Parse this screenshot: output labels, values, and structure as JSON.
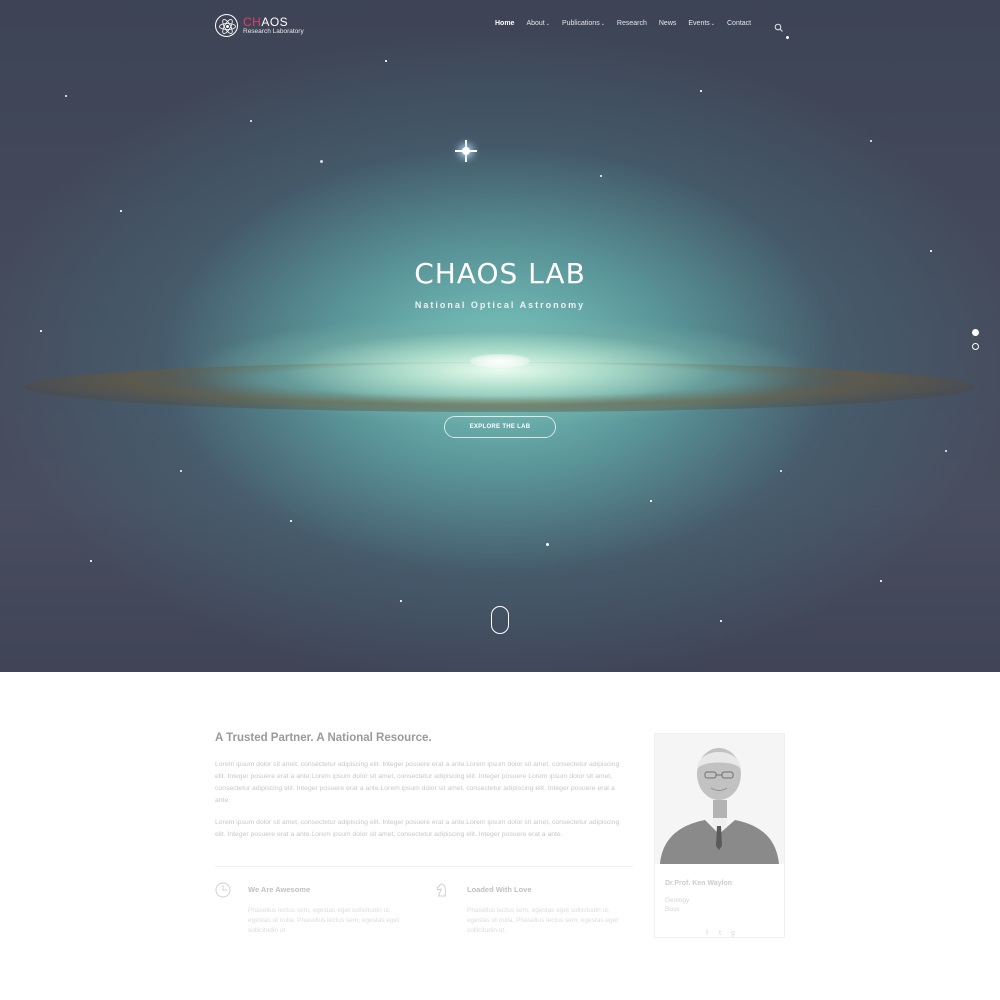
{
  "brand": {
    "name_accent": "CH",
    "name_rest": "AOS",
    "subtitle": "Research Laboratory",
    "accent_color": "#e0406a"
  },
  "nav": {
    "items": [
      {
        "label": "Home",
        "active": true,
        "dropdown": false
      },
      {
        "label": "About",
        "active": false,
        "dropdown": true
      },
      {
        "label": "Publications",
        "active": false,
        "dropdown": true
      },
      {
        "label": "Research",
        "active": false,
        "dropdown": false
      },
      {
        "label": "News",
        "active": false,
        "dropdown": false
      },
      {
        "label": "Events",
        "active": false,
        "dropdown": true
      },
      {
        "label": "Contact",
        "active": false,
        "dropdown": false
      }
    ],
    "search_icon": "search-icon"
  },
  "hero": {
    "title": "CHAOS LAB",
    "subtitle": "National Optical Astronomy",
    "button_label": "EXPLORE THE LAB",
    "slides": {
      "count": 2,
      "active_index": 0
    }
  },
  "about": {
    "title": "A Trusted Partner. A National Resource.",
    "paragraphs": [
      "Lorem ipsum dolor sit amet, consectetur adipiscing elit. Integer posuere erat a ante.Lorem ipsum dolor sit amet, consectetur adipiscing elit. Integer posuere erat a ante.Lorem ipsum dolor sit amet, consectetur adipiscing elit. Integer posuere Lorem ipsum dolor sit amet, consectetur adipiscing elit. Integer posuere erat a ante.Lorem ipsum dolor sit amet, consectetur adipiscing elit. Integer posuere erat a ante.",
      "Lorem ipsum dolor sit amet, consectetur adipiscing elit. Integer posuere erat a ante.Lorem ipsum dolor sit amet, consectetur adipiscing elit. Integer posuere erat a ante.Lorem ipsum dolor sit amet, consectetur adipiscing elit. Integer posuere erat a ante."
    ],
    "features": [
      {
        "icon": "clock-icon",
        "title": "We Are Awesome",
        "text": "Phasellus lectus sem, egestas eget sollicitudin ut, egestas ut nulla. Phasellus lectus sem, egestas eget sollicitudin ut."
      },
      {
        "icon": "chess-knight-icon",
        "title": "Loaded With Love",
        "text": "Phasellus lectus sem, egestas eget sollicitudin ut, egestas ut nulla. Phasellus lectus sem, egestas eget sollicitudin ut."
      }
    ]
  },
  "profile": {
    "name": "Dr.Prof. Ken Waylon",
    "role_lines": [
      "Geology",
      "Boss"
    ],
    "socials": [
      "facebook-icon",
      "twitter-icon",
      "google-plus-icon"
    ]
  }
}
